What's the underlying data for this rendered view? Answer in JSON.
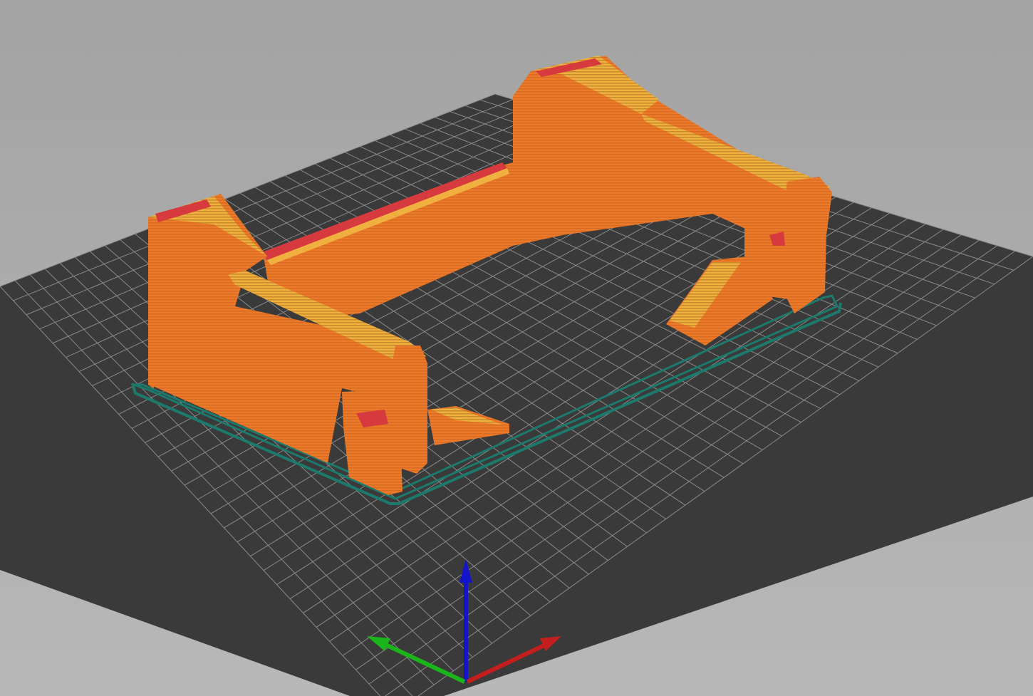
{
  "viewport": {
    "background_top": "#a3a3a3",
    "background_bottom": "#b8b8b8"
  },
  "bed": {
    "plate_color": "#3a3a3a",
    "grid_color": "#8a8a8a"
  },
  "model": {
    "wall_color": "#ec7a2b",
    "top_color": "#e9a63a",
    "cap_color": "#d63a3e",
    "shadow_color": "#c9651f",
    "skirt_color": "#1c7a6c"
  },
  "axes": {
    "x_color": "#c41e1e",
    "y_color": "#1bb51b",
    "z_color": "#1414c8"
  }
}
